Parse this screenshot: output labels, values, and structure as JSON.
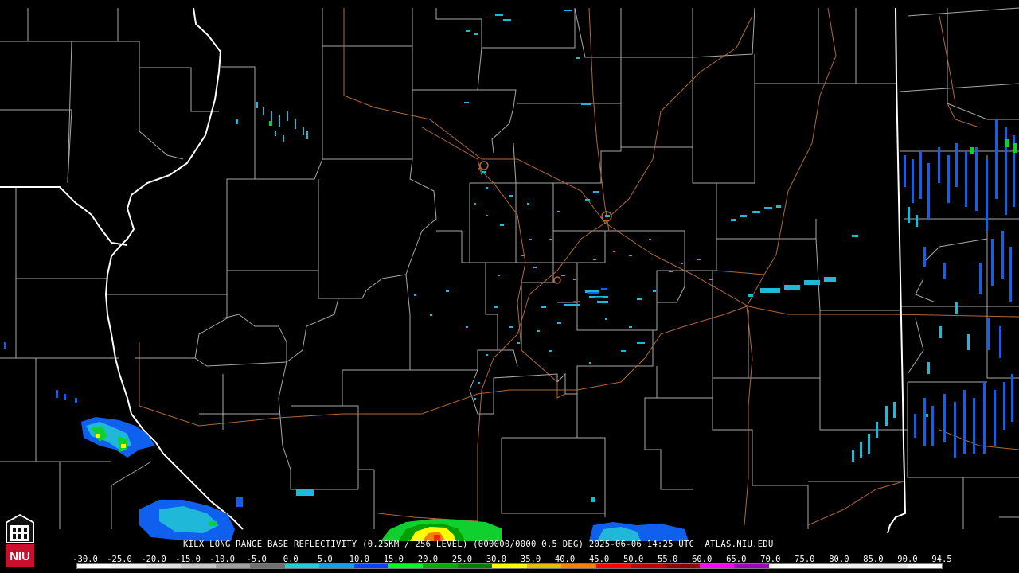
{
  "product": {
    "caption": "KILX LONG RANGE BASE REFLECTIVITY (0.25KM / 256 LEVEL) (000000/0000 0.5 DEG) 2025-06-06 14:25 UTC  ATLAS.NIU.EDU"
  },
  "logo": {
    "text": "NIU"
  },
  "scale": {
    "labels": [
      "-30.0",
      "-25.0",
      "-20.0",
      "-15.0",
      "-10.0",
      "-5.0",
      "0.0",
      "5.0",
      "10.0",
      "15.0",
      "20.0",
      "25.0",
      "30.0",
      "35.0",
      "40.0",
      "45.0",
      "50.0",
      "55.0",
      "60.0",
      "65.0",
      "70.0",
      "75.0",
      "80.0",
      "85.0",
      "90.0",
      "94.5"
    ],
    "colors": [
      "#ffffff",
      "#f0f0f0",
      "#e0e0e0",
      "#c8c8c8",
      "#a0a0a0",
      "#707070",
      "#20d0d0",
      "#10a0f0",
      "#1040ff",
      "#00ff20",
      "#00b000",
      "#007a00",
      "#ffff00",
      "#e0c000",
      "#ff8000",
      "#ff0000",
      "#c00000",
      "#900000",
      "#ff00ff",
      "#a000c0",
      "#ffffff",
      "#f8f8f8",
      "#f0f0f0",
      "#e8e8e8",
      "#ffffff"
    ]
  },
  "map": {
    "colors": {
      "state_border": "#ffffff",
      "county_border": "#a8a8a8",
      "highway": "#b06838",
      "echo_light": "#20b8d8",
      "echo_mid": "#1060f0",
      "echo_green": "#10d030",
      "echo_yellow": "#ffff00",
      "echo_red": "#ff2000"
    }
  }
}
